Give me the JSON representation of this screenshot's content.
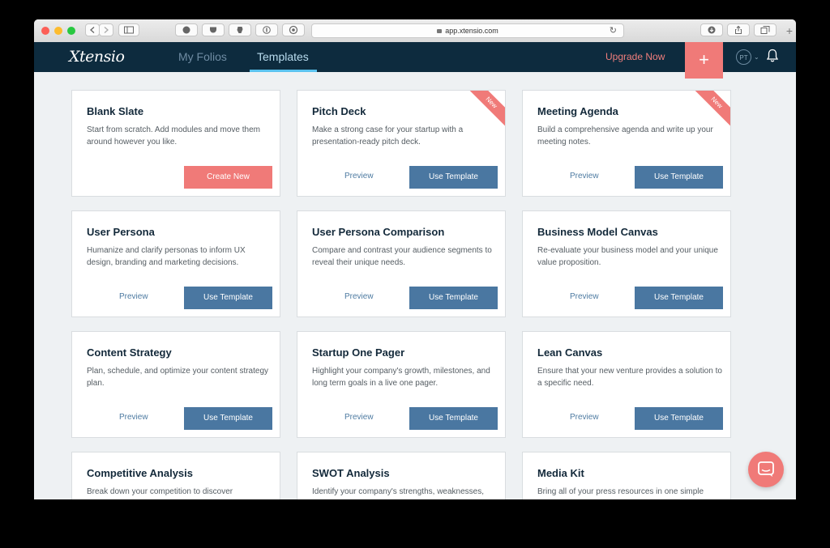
{
  "browser": {
    "url": "app.xtensio.com",
    "new_tab": "+"
  },
  "nav": {
    "logo": "Xtensio",
    "my_folios": "My Folios",
    "templates": "Templates",
    "upgrade": "Upgrade Now",
    "plus": "+",
    "avatar_initials": "PT",
    "caret": "⌄"
  },
  "cards": [
    {
      "title": "Blank Slate",
      "desc": "Start from scratch. Add modules and move them around however you like.",
      "action": "Create New"
    },
    {
      "title": "Pitch Deck",
      "desc": "Make a strong case for your startup with a presentation-ready pitch deck.",
      "preview": "Preview",
      "action": "Use Template",
      "badge": "New"
    },
    {
      "title": "Meeting Agenda",
      "desc": "Build a comprehensive agenda and write up your meeting notes.",
      "preview": "Preview",
      "action": "Use Template",
      "badge": "New"
    },
    {
      "title": "User Persona",
      "desc": "Humanize and clarify personas to inform UX design, branding and marketing decisions.",
      "preview": "Preview",
      "action": "Use Template"
    },
    {
      "title": "User Persona Comparison",
      "desc": "Compare and contrast your audience segments to reveal their unique needs.",
      "preview": "Preview",
      "action": "Use Template"
    },
    {
      "title": "Business Model Canvas",
      "desc": "Re-evaluate your business model and your unique value proposition.",
      "preview": "Preview",
      "action": "Use Template"
    },
    {
      "title": "Content Strategy",
      "desc": "Plan, schedule, and optimize your content strategy plan.",
      "preview": "Preview",
      "action": "Use Template"
    },
    {
      "title": "Startup One Pager",
      "desc": "Highlight your company's growth, milestones, and long term goals in a live one pager.",
      "preview": "Preview",
      "action": "Use Template"
    },
    {
      "title": "Lean Canvas",
      "desc": "Ensure that your new venture provides a solution to a specific need.",
      "preview": "Preview",
      "action": "Use Template"
    },
    {
      "title": "Competitive Analysis",
      "desc": "Break down your competition to discover"
    },
    {
      "title": "SWOT Analysis",
      "desc": "Identify your company's strengths, weaknesses,"
    },
    {
      "title": "Media Kit",
      "desc": "Bring all of your press resources in one simple"
    }
  ],
  "colors": {
    "nav_bg": "#0d2b3e",
    "accent_coral": "#f07a78",
    "button_blue": "#4a77a1",
    "active_underline": "#5cc3ef"
  }
}
